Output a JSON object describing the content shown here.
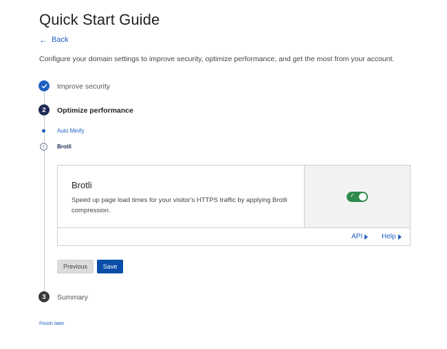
{
  "page": {
    "title": "Quick Start Guide",
    "back_label": "Back",
    "intro": "Configure your domain settings to improve security, optimize performance, and get the most from your account."
  },
  "steps": [
    {
      "label": "Improve security",
      "status": "complete",
      "marker": "✓"
    },
    {
      "label": "Optimize performance",
      "status": "active",
      "marker": "2"
    },
    {
      "label": "Summary",
      "status": "pending",
      "marker": "3"
    }
  ],
  "substeps": [
    {
      "label": "Auto Minify",
      "status": "complete"
    },
    {
      "label": "Brotli",
      "status": "active",
      "marker": "c"
    }
  ],
  "card": {
    "title": "Brotli",
    "description": "Speed up page load times for your visitor's HTTPS traffic by applying Brotli compression.",
    "toggle_on": true,
    "toggle_color": "#2e8b4e",
    "links": {
      "api": "API",
      "help": "Help"
    }
  },
  "buttons": {
    "previous": "Previous",
    "save": "Save"
  },
  "footer": {
    "finish_later": "Finish later"
  }
}
